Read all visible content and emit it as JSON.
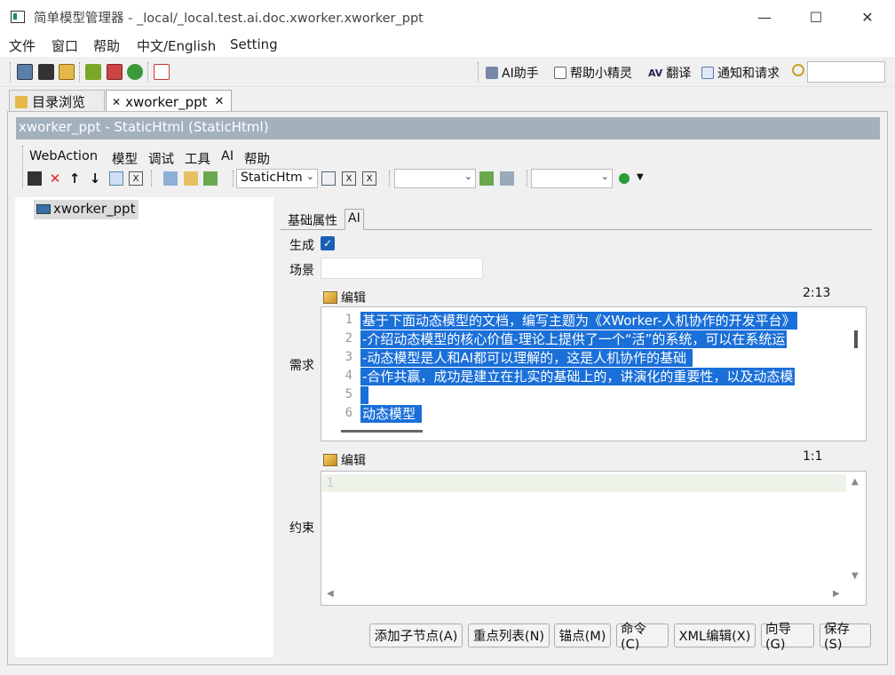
{
  "window": {
    "title": "简单模型管理器 - _local/_local.test.ai.doc.xworker.xworker_ppt",
    "minimize": "—",
    "maximize": "☐",
    "close": "✕"
  },
  "menubar": [
    "文件",
    "窗口",
    "帮助",
    "中文/English",
    "Setting"
  ],
  "toolbar_right": {
    "ai_assistant": "AI助手",
    "helper": "帮助小精灵",
    "translate": "翻译",
    "notify": "通知和请求",
    "search_placeholder": ""
  },
  "tabs": [
    {
      "label": "目录浏览",
      "active": false
    },
    {
      "label": "xworker_ppt",
      "active": true,
      "close": "✕"
    }
  ],
  "model_header": "xworker_ppt - StaticHtml  (StaticHtml)",
  "inner_menu": [
    "WebAction",
    "模型",
    "调试",
    "工具",
    "AI",
    "帮助"
  ],
  "inner_toolbar": {
    "type_combo": "StaticHtm",
    "combo2": "",
    "combo3": ""
  },
  "tree": {
    "item": "xworker_ppt"
  },
  "props_tabs": [
    "基础属性",
    "AI"
  ],
  "form": {
    "generate_label": "生成",
    "generate_checked": true,
    "scene_label": "场景",
    "scene_value": "",
    "requirement_label": "需求",
    "constraint_label": "约束"
  },
  "editor1": {
    "header": "编辑",
    "position": "2:13",
    "lines": [
      {
        "n": "1",
        "text": "基于下面动态模型的文档，编写主题为《XWorker-人机协作的开发平台》"
      },
      {
        "n": "2",
        "text": "-介绍动态模型的核心价值-理论上提供了一个“活”的系统，可以在系统运"
      },
      {
        "n": "3",
        "text": "-动态模型是人和AI都可以理解的，这是人机协作的基础 "
      },
      {
        "n": "4",
        "text": "-合作共赢，成功是建立在扎实的基础上的，讲演化的重要性，以及动态模"
      },
      {
        "n": "5",
        "text": " "
      },
      {
        "n": "6",
        "text": "动态模型 "
      }
    ]
  },
  "editor2": {
    "header": "编辑",
    "position": "1:1",
    "lines": [
      {
        "n": "1",
        "text": ""
      }
    ]
  },
  "buttons": [
    "添加子节点(A)",
    "重点列表(N)",
    "锚点(M)",
    "命令(C)",
    "XML编辑(X)",
    "向导(G)",
    "保存(S)"
  ]
}
